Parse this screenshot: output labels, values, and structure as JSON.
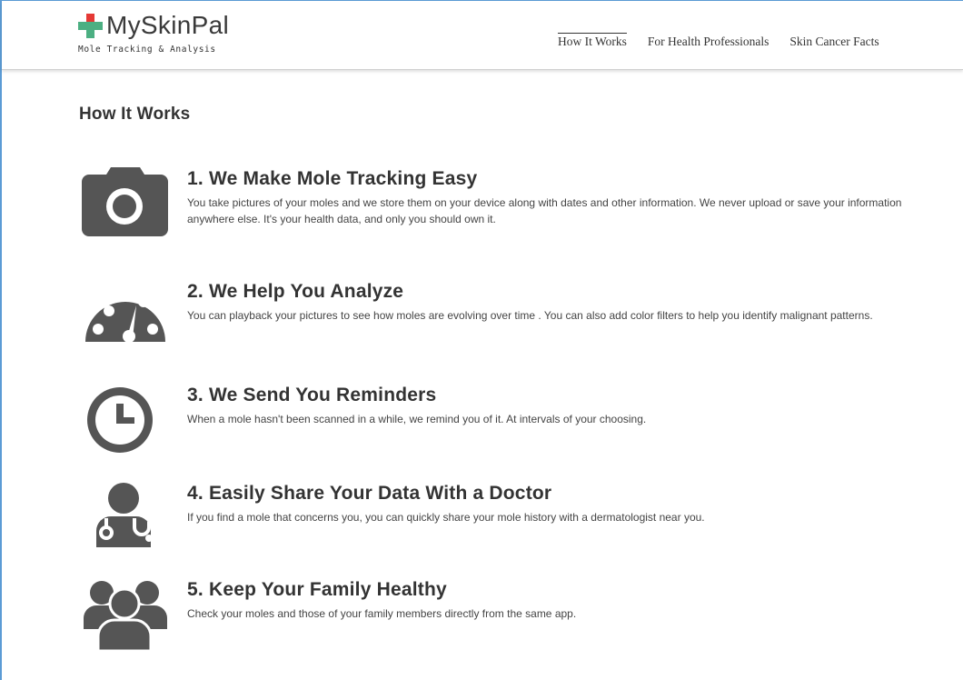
{
  "brand": {
    "name": "MySkinPal",
    "tagline": "Mole Tracking & Analysis",
    "accent_green": "#4caf82",
    "accent_red": "#e53935"
  },
  "nav": {
    "items": [
      {
        "label": "How It Works",
        "active": true
      },
      {
        "label": "For Health Professionals",
        "active": false
      },
      {
        "label": "Skin Cancer Facts",
        "active": false
      }
    ]
  },
  "main": {
    "title": "How It Works",
    "features": [
      {
        "icon": "camera-icon",
        "heading": "1. We Make Mole Tracking Easy",
        "body": "You take pictures of your moles and we store them on your device along with dates and other information. We never upload or save your information anywhere else. It's your health data, and only you should own it."
      },
      {
        "icon": "gauge-icon",
        "heading": "2. We Help You Analyze",
        "body": "You can playback your pictures to see how moles are evolving over time . You can also add color filters to help you identify malignant patterns."
      },
      {
        "icon": "clock-icon",
        "heading": "3. We Send You Reminders",
        "body": "When a mole hasn't been scanned in a while, we remind you of it. At intervals of your choosing."
      },
      {
        "icon": "doctor-icon",
        "heading": "4. Easily Share Your Data With a Doctor",
        "body": "If you find a mole that concerns you, you can quickly share your mole history with a dermatologist near you."
      },
      {
        "icon": "family-icon",
        "heading": "5. Keep Your Family Healthy",
        "body": "Check your moles and those of your family members directly from the same app."
      }
    ]
  }
}
